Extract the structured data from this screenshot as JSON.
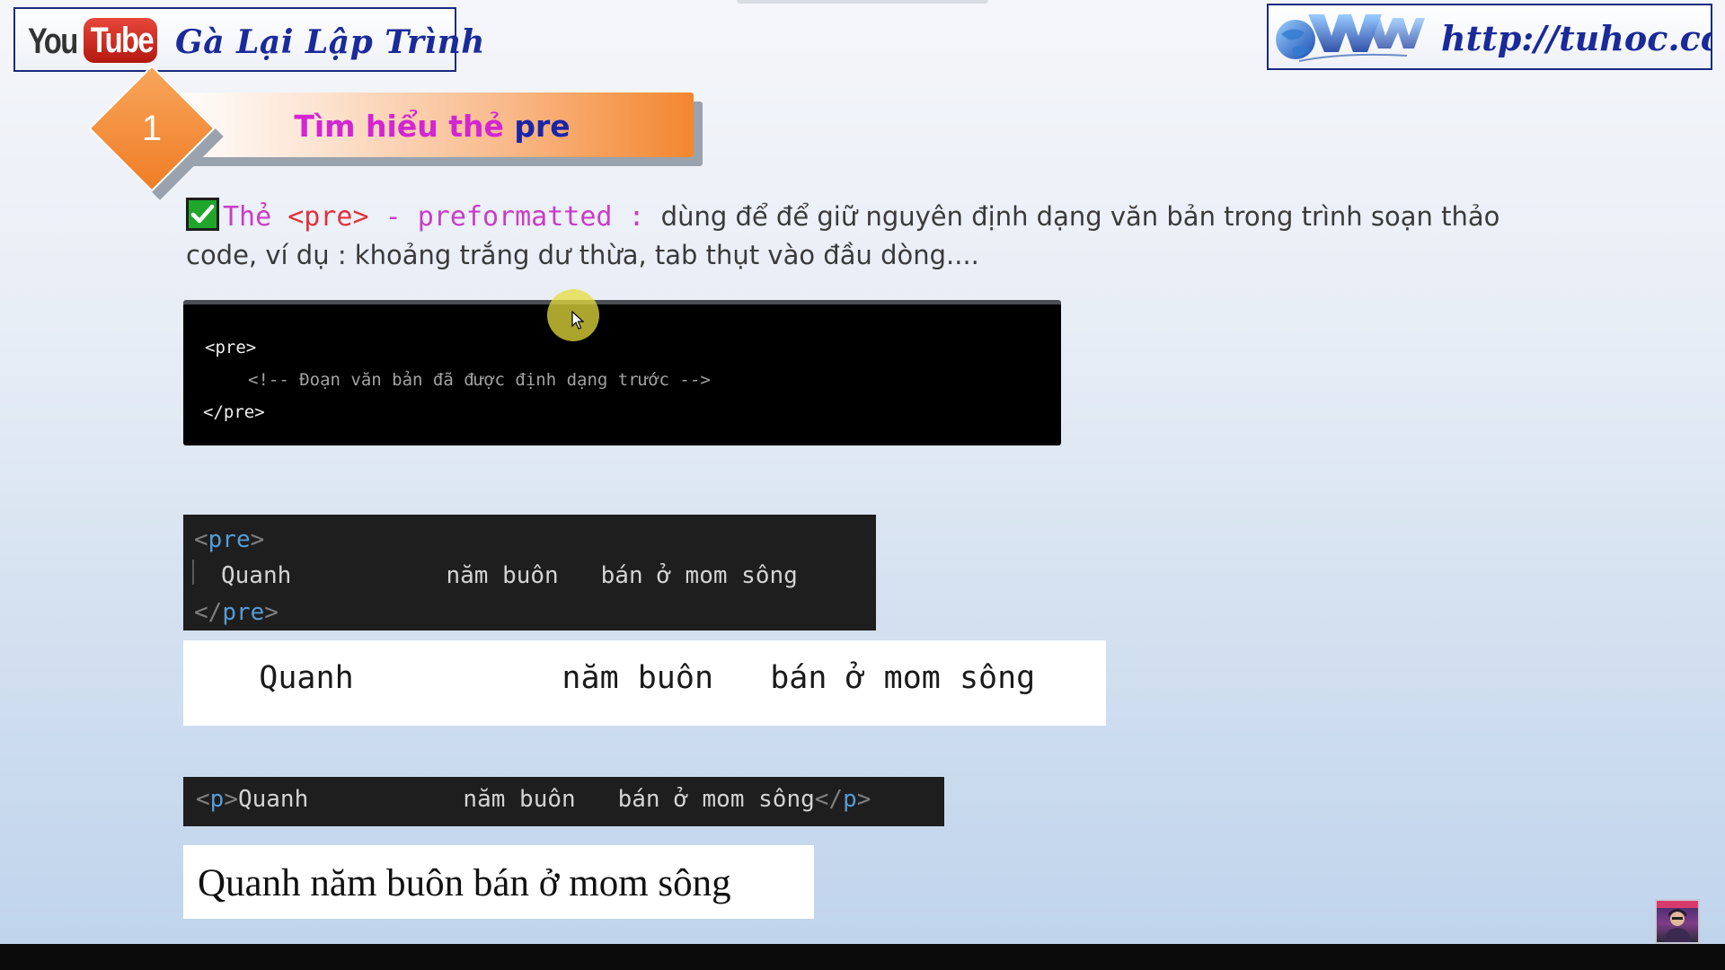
{
  "header": {
    "youtube_you": "You",
    "youtube_tube": "Tube",
    "channel_name": "Gà Lại Lập Trình",
    "site_url": "http://tuhoc.cc"
  },
  "section": {
    "number": "1",
    "title_prefix": "Tìm hiểu thẻ ",
    "title_accent": "pre"
  },
  "description": {
    "term_prefix": "Thẻ ",
    "tag": "<pre>",
    "term_suffix": " - preformatted : ",
    "text": " dùng để để giữ nguyên định dạng văn bản trong trình soạn thảo code, ví dụ : khoảng trắng dư thừa, tab thụt vào đầu dòng...."
  },
  "code_example_1": {
    "line1": "<pre>",
    "line2": "<!-- Đoạn văn bản đã được định dạng trước -->",
    "line3": "</pre>"
  },
  "code_example_2": {
    "open_lt": "<",
    "open_name": "pre",
    "open_gt": ">",
    "content": "Quanh           năm buôn   bán ở mom sông",
    "close_lt": "</",
    "close_name": "pre",
    "close_gt": ">"
  },
  "output_pre": {
    "text": "    Quanh           năm buôn   bán ở mom sông"
  },
  "code_example_3": {
    "open_lt": "<",
    "open_name": "p",
    "open_gt": ">",
    "content": "Quanh           năm buôn   bán ở mom sông",
    "close_lt": "</",
    "close_name": "p",
    "close_gt": ">"
  },
  "output_p": {
    "text": "Quanh năm buôn bán ở mom sông"
  },
  "colors": {
    "title_magenta": "#d325d3",
    "title_blue": "#1a26a8",
    "tag_red": "#e0323c",
    "term_magenta": "#c93dc6",
    "banner_orange": "#f4862e",
    "brand_blue": "#1a2a9a"
  },
  "icons": {
    "check": "check-icon",
    "cursor": "cursor-icon",
    "globe": "www-globe-icon"
  }
}
